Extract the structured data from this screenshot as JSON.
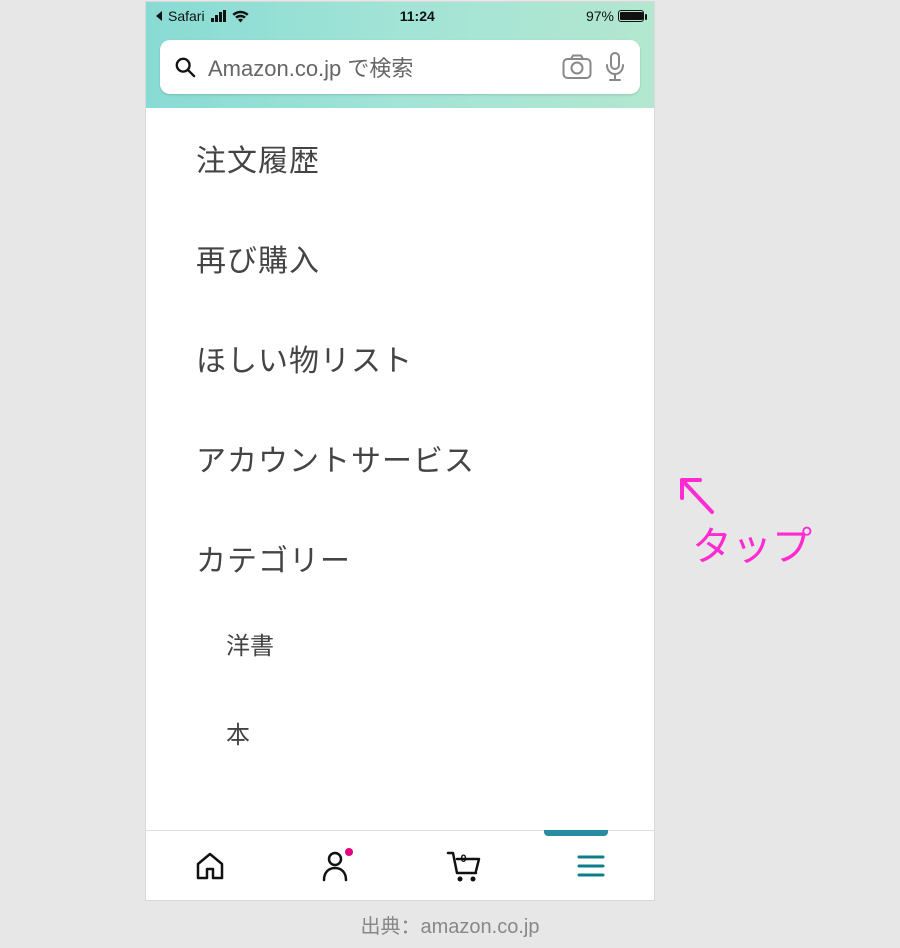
{
  "statusbar": {
    "back_app": "Safari",
    "time": "11:24",
    "battery_pct": "97%"
  },
  "search": {
    "placeholder": "Amazon.co.jp で検索"
  },
  "menu": {
    "items": [
      "注文履歴",
      "再び購入",
      "ほしい物リスト",
      "アカウントサービス",
      "カテゴリー"
    ],
    "sub_items": [
      "洋書",
      "本"
    ]
  },
  "bottom_nav": {
    "cart_count": "0"
  },
  "annotation": {
    "label": "タップ"
  },
  "caption": "出典：amazon.co.jp"
}
